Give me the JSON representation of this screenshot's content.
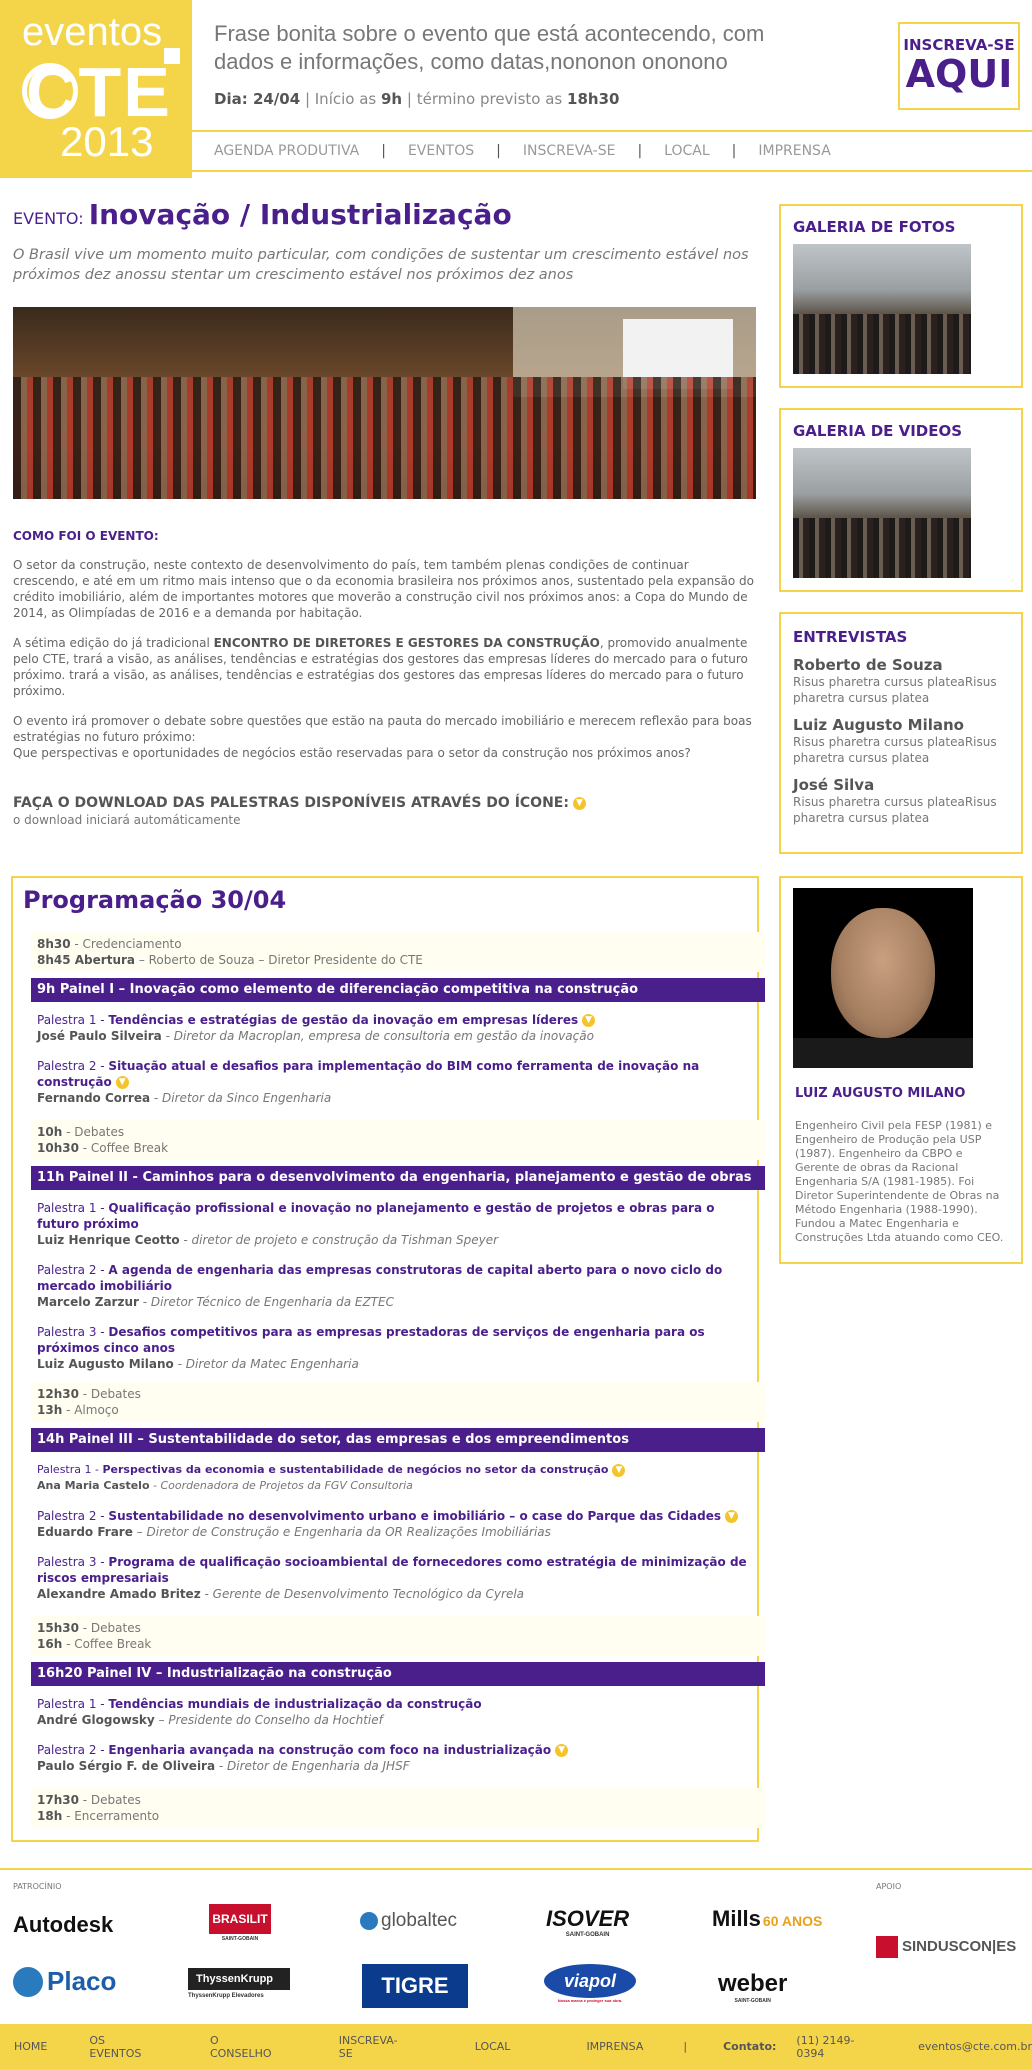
{
  "header": {
    "logo_line1": "eventos",
    "logo_line2": "CTE",
    "logo_line3": "2013",
    "tagline": "Frase bonita sobre o evento que está acontecendo, com dados e informações, como datas,nononon ononono",
    "date_label": "Dia: ",
    "date_value": "24/04",
    "start_label": " | Início as ",
    "start_value": "9h",
    "end_label": " | término previsto as ",
    "end_value": "18h30",
    "signup_line1": "INSCREVA-SE",
    "signup_line2": "AQUI"
  },
  "nav": [
    "AGENDA PRODUTIVA",
    "EVENTOS",
    "INSCREVA-SE",
    "LOCAL",
    "IMPRENSA"
  ],
  "event": {
    "prefix": "EVENTO: ",
    "title": "Inovação / Industrialização",
    "description": "O Brasil vive um momento muito particular, com condições de sustentar um crescimento estável nos próximos dez anossu stentar um crescimento estável nos próximos dez anos",
    "como_title": "COMO FOI O EVENTO:",
    "para1": "O setor da construção, neste contexto de desenvolvimento do país, tem também plenas condições de continuar crescendo, e até em um ritmo mais intenso que o da economia brasileira nos próximos anos, sustentado pela expansão do crédito imobiliário, além de importantes motores que moverão a construção civil nos próximos anos: a Copa do Mundo de 2014, as Olimpíadas de 2016 e a demanda por habitação.",
    "para2_a": "A sétima edição do já tradicional ",
    "para2_b": "ENCONTRO DE DIRETORES E GESTORES DA CONSTRUÇÃO",
    "para2_c": ", promovido anualmente pelo CTE, trará a visão, as análises, tendências e estratégias dos gestores das empresas líderes do mercado para o futuro próximo. trará a visão, as análises, tendências e estratégias dos gestores das empresas líderes do mercado para o futuro próximo.",
    "para3": "O evento irá promover o debate sobre questões que estão na pauta do mercado imobiliário e merecem reflexão para boas estratégias no futuro próximo:",
    "para4": "Que perspectivas e oportunidades de negócios estão reservadas para o setor da construção nos próximos anos?",
    "download_title": "FAÇA O DOWNLOAD DAS PALESTRAS DISPONÍVEIS ATRAVÉS DO ÍCONE:",
    "download_sub": "o download iniciará automáticamente"
  },
  "sidebar": {
    "photos_title": "GALERIA DE FOTOS",
    "videos_title": "GALERIA DE VIDEOS",
    "interviews_title": "ENTREVISTAS",
    "interviews": [
      {
        "name": "Roberto de Souza",
        "text": "Risus pharetra cursus plateaRisus pharetra cursus platea"
      },
      {
        "name": "Luiz Augusto Milano",
        "text": "Risus pharetra cursus plateaRisus pharetra cursus platea"
      },
      {
        "name": "José Silva",
        "text": "Risus pharetra cursus plateaRisus pharetra cursus platea"
      }
    ],
    "bio_name": "LUIZ AUGUSTO MILANO",
    "bio_text": "Engenheiro Civil pela FESP (1981) e Engenheiro de Produção pela USP (1987). Engenheiro da CBPO e Gerente de obras da Racional Engenharia S/A (1981-1985). Foi Diretor Superintendente de Obras na Método Engenharia (1988-1990). Fundou a Matec Engenharia e Construções Ltda atuando como CEO."
  },
  "program": {
    "title": "Programação 30/04",
    "blocks": {
      "b1": [
        {
          "time": "8h30",
          "text": " - Credenciamento"
        },
        {
          "time": "8h45 Abertura",
          "text": " – Roberto de Souza – Diretor Presidente do CTE"
        }
      ],
      "p1": "9h Painel I – Inovação como elemento de diferenciação competitiva na construção",
      "p1_talks": [
        {
          "num": "Palestra 1 - ",
          "title": "Tendências e estratégias de gestão da inovação em empresas líderes",
          "speaker": "José Paulo Silveira",
          "role": " - Diretor da Macroplan, empresa de consultoria em gestão da inovação"
        },
        {
          "num": "Palestra 2 - ",
          "title": "Situação atual e desafios para implementação do BIM como ferramenta de inovação na construção",
          "speaker": "Fernando Correa",
          "role": " - Diretor da Sinco Engenharia"
        }
      ],
      "b2": [
        {
          "time": "10h",
          "text": " - Debates"
        },
        {
          "time": "10h30",
          "text": " - Coffee Break"
        }
      ],
      "p2": "11h Painel II - Caminhos para o desenvolvimento da engenharia, planejamento e gestão de obras",
      "p2_talks": [
        {
          "num": "Palestra 1 - ",
          "title": "Qualificação profissional e inovação no planejamento e gestão de projetos e obras para o futuro próximo",
          "speaker": "Luiz Henrique Ceotto",
          "role": " - diretor de projeto e construção da Tishman Speyer"
        },
        {
          "num": "Palestra 2 - ",
          "title": "A agenda de engenharia das empresas construtoras de capital aberto para o novo ciclo do mercado imobiliário",
          "speaker": "Marcelo Zarzur",
          "role": " - Diretor Técnico de Engenharia da EZTEC"
        },
        {
          "num": "Palestra 3 - ",
          "title": "Desafios competitivos para as empresas prestadoras de serviços de engenharia para os próximos cinco anos",
          "speaker": "Luiz Augusto Milano",
          "role": " - Diretor da Matec Engenharia"
        }
      ],
      "b3": [
        {
          "time": "12h30",
          "text": " - Debates"
        },
        {
          "time": "13h",
          "text": " - Almoço"
        }
      ],
      "p3": "14h Painel III – Sustentabilidade do setor, das empresas e dos empreendimentos",
      "p3_talks": [
        {
          "num": "Palestra 1 - ",
          "title": "Perspectivas da economia e sustentabilidade de negócios no setor da construção",
          "speaker": "Ana Maria Castelo",
          "role": " - Coordenadora de Projetos da FGV Consultoria"
        },
        {
          "num": "Palestra 2 - ",
          "title": "Sustentabilidade no desenvolvimento urbano e imobiliário – o case do Parque das Cidades",
          "speaker": "Eduardo Frare",
          "role": " – Diretor de Construção e Engenharia da OR Realizações Imobiliárias"
        },
        {
          "num": "Palestra 3 - ",
          "title": "Programa de qualificação socioambiental de fornecedores como estratégia de minimização de riscos empresariais",
          "speaker": "Alexandre Amado Britez",
          "role": " - Gerente de Desenvolvimento Tecnológico da Cyrela"
        }
      ],
      "b4": [
        {
          "time": "15h30",
          "text": " - Debates"
        },
        {
          "time": "16h",
          "text": " - Coffee Break"
        }
      ],
      "p4": "16h20 Painel IV – Industrialização na construção",
      "p4_talks": [
        {
          "num": "Palestra 1 - ",
          "title": "Tendências mundiais de industrialização da construção",
          "speaker": "André Glogowsky",
          "role": " – Presidente do Conselho da Hochtief"
        },
        {
          "num": "Palestra 2 - ",
          "title": "Engenharia avançada na construção com foco na industrialização",
          "speaker": "Paulo Sérgio F. de Oliveira",
          "role": " - Diretor de Engenharia da JHSF"
        }
      ],
      "b5": [
        {
          "time": "17h30",
          "text": " - Debates"
        },
        {
          "time": "18h",
          "text": " - Encerramento"
        }
      ]
    }
  },
  "sponsors": {
    "label": "PATROCÍNIO",
    "apoio_label": "APOIO",
    "names": [
      "Autodesk",
      "BRASILIT",
      "globaltec",
      "ISOVER",
      "Mills",
      "Placo",
      "ThyssenKrupp",
      "TIGRE",
      "viapol",
      "weber",
      "SINDUSCON|ES"
    ],
    "sub_saint_gobain": "SAINT-GOBAIN",
    "sub_thyssen": "ThyssenKrupp Elevadores",
    "sub_viapol": "Nossa marca é proteger sua obra.",
    "mills_anos": "60 ANOS"
  },
  "footer": {
    "items": [
      "HOME",
      "OS EVENTOS",
      "O CONSELHO",
      "INSCREVA-SE",
      "LOCAL",
      "IMPRENSA"
    ],
    "contact_label": "Contato:",
    "phone": "(11) 2149-0394",
    "email": "eventos@cte.com.br"
  },
  "colors": {
    "brand_yellow": "#f4d54a",
    "brand_purple": "#4a1f8c",
    "download_icon": "#f4c52a"
  }
}
